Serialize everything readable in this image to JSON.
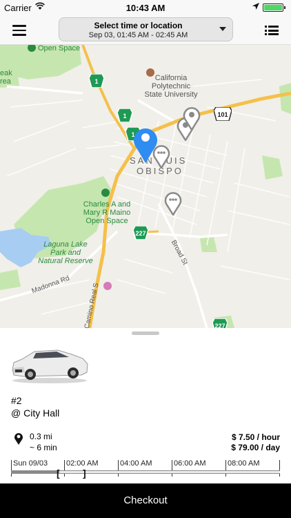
{
  "status_bar": {
    "carrier": "Carrier",
    "time": "10:43 AM"
  },
  "nav": {
    "time_select_title": "Select time or location",
    "time_select_range": "Sep 03, 01:45 AM - 02:45 AM"
  },
  "map": {
    "labels": {
      "open_space_top": "Open Space",
      "left_edge_1": "eak",
      "left_edge_2": "rea",
      "cal_poly_1": "California",
      "cal_poly_2": "Polytechnic",
      "cal_poly_3": "State University",
      "city_1": "SAN LUIS",
      "city_2": "OBISPO",
      "maino_1": "Charles A and",
      "maino_2": "Mary R Maino",
      "maino_3": "Open Space",
      "laguna_1": "Laguna Lake",
      "laguna_2": "Park and",
      "laguna_3": "Natural Reserve",
      "madonna_rd": "Madonna Rd",
      "broad_st": "Broad St",
      "camino_real": "Camino Real S"
    },
    "shields": {
      "hwy1_a": "1",
      "hwy1_b": "1",
      "hwy1_c": "1",
      "hwy101": "101",
      "hwy227_a": "227",
      "hwy227_b": "227"
    }
  },
  "vehicle": {
    "id": "#2",
    "location": "@ City Hall",
    "distance": "0.3 mi",
    "walk_time": "~ 6 min",
    "rate_hour": "$ 7.50 / hour",
    "rate_day": "$ 79.00 / day"
  },
  "timeline": {
    "date_label": "Sun 09/03",
    "tick_1": "02:00 AM",
    "tick_2": "04:00 AM",
    "tick_3": "06:00 AM",
    "tick_4": "08:00 AM"
  },
  "checkout_label": "Checkout",
  "colors": {
    "accent_pin": "#2f8cf0",
    "park_green": "#c6e6b0",
    "water": "#a7cdf2",
    "highway": "#f5c04a",
    "checkout_bg": "#000000"
  }
}
